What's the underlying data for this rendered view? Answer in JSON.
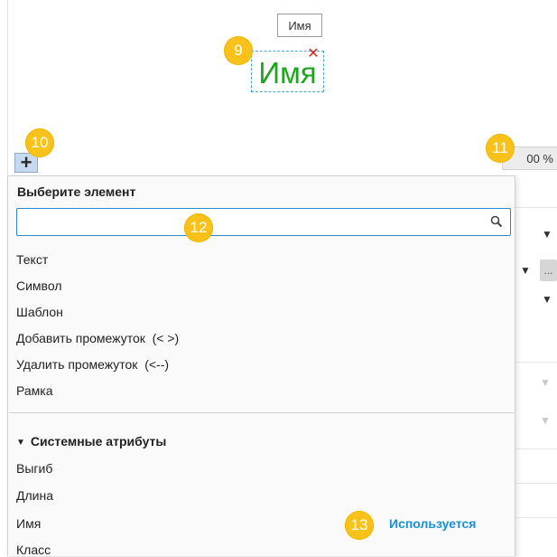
{
  "preview": {
    "tooltip": "Имя",
    "element_text": "Имя",
    "element_color": "#1da51d"
  },
  "badges": {
    "b9": "9",
    "b10": "10",
    "b11": "11",
    "b12": "12",
    "b13": "13"
  },
  "toolbar": {
    "add_label": "+",
    "zoom_value": "00 %"
  },
  "dropdown": {
    "title": "Выберите элемент",
    "search": {
      "value": "",
      "placeholder": ""
    },
    "items": [
      "Текст",
      "Символ",
      "Шаблон",
      "Добавить промежуток  (< >)",
      "Удалить промежуток  (<--)",
      "Рамка"
    ],
    "system_section": {
      "header": "Системные атрибуты",
      "items": [
        "Выгиб",
        "Длина",
        "Имя",
        "Класс"
      ],
      "used_label": "Используется"
    }
  },
  "background_controls": {
    "ellipsis": "..."
  },
  "colors": {
    "accent": "#2f88cf",
    "badge": "#f8c21a",
    "used": "#1a8fd6",
    "remove": "#e02020"
  },
  "icons": [
    "search-icon",
    "close-icon",
    "plus-icon",
    "dropdown-arrow-icon",
    "triangle-down-icon"
  ]
}
